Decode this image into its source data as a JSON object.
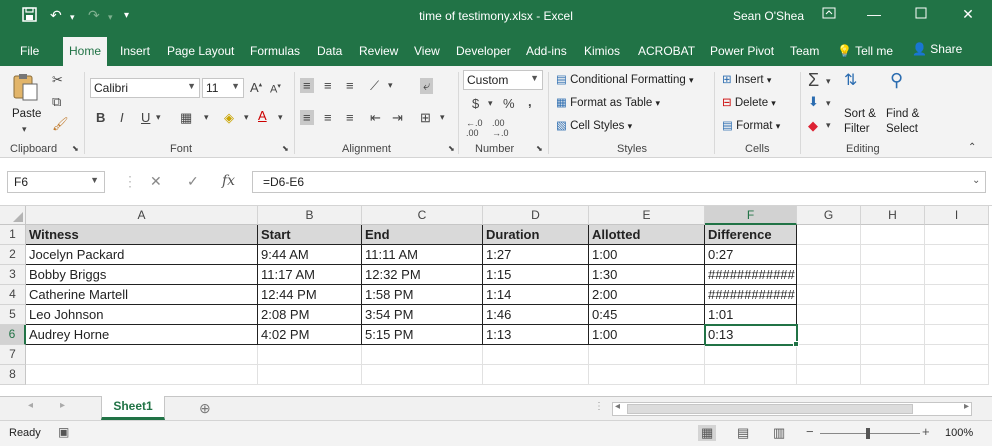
{
  "titlebar": {
    "file_title": "time of testimony.xlsx  -  Excel",
    "user": "Sean O'Shea",
    "icons": [
      "save-icon",
      "undo-icon",
      "redo-icon",
      "customize-icon",
      "ribbon-display-icon",
      "minimize-icon",
      "maximize-icon",
      "close-icon"
    ]
  },
  "tabs": [
    "File",
    "Home",
    "Insert",
    "Page Layout",
    "Formulas",
    "Data",
    "Review",
    "View",
    "Developer",
    "Add-ins",
    "Kimios",
    "ACROBAT",
    "Power Pivot",
    "Team",
    "Tell me",
    "Share"
  ],
  "active_tab": "Home",
  "ribbon": {
    "clipboard": {
      "label": "Clipboard",
      "paste": "Paste"
    },
    "font": {
      "label": "Font",
      "name": "Calibri",
      "size": "11",
      "bold": "B",
      "italic": "I",
      "underline": "U"
    },
    "alignment": {
      "label": "Alignment"
    },
    "number": {
      "label": "Number",
      "format": "Custom",
      "currency": "$",
      "percent": "%",
      "comma": ","
    },
    "styles": {
      "label": "Styles",
      "conditional": "Conditional Formatting",
      "format_table": "Format as Table",
      "cell_styles": "Cell Styles"
    },
    "cells": {
      "label": "Cells",
      "insert": "Insert",
      "delete": "Delete",
      "format": "Format"
    },
    "editing": {
      "label": "Editing",
      "sort1": "Sort &",
      "sort2": "Filter",
      "find1": "Find &",
      "find2": "Select"
    }
  },
  "formula_bar": {
    "name_box": "F6",
    "fx": "fx",
    "formula": "=D6-E6"
  },
  "columns": [
    "A",
    "B",
    "C",
    "D",
    "E",
    "F",
    "G",
    "H",
    "I"
  ],
  "rows": [
    "1",
    "2",
    "3",
    "4",
    "5",
    "6",
    "7",
    "8"
  ],
  "table": {
    "headers": [
      "Witness",
      "Start",
      "End",
      "Duration",
      "Allotted",
      "Difference"
    ],
    "rows": [
      [
        "Jocelyn Packard",
        "9:44 AM",
        "11:11 AM",
        "1:27",
        "1:00",
        "0:27"
      ],
      [
        "Bobby Briggs",
        "11:17 AM",
        "12:32 PM",
        "1:15",
        "1:30",
        "############"
      ],
      [
        "Catherine Martell",
        "12:44 PM",
        "1:58 PM",
        "1:14",
        "2:00",
        "############"
      ],
      [
        "Leo Johnson",
        "2:08 PM",
        "3:54 PM",
        "1:46",
        "0:45",
        "1:01"
      ],
      [
        "Audrey Horne",
        "4:02 PM",
        "5:15 PM",
        "1:13",
        "1:00",
        "0:13"
      ]
    ]
  },
  "sheet_tabs": [
    "Sheet1"
  ],
  "status": {
    "ready": "Ready",
    "zoom": "100%"
  },
  "colors": {
    "brand": "#217346",
    "header_fill": "#d9d9d9"
  }
}
